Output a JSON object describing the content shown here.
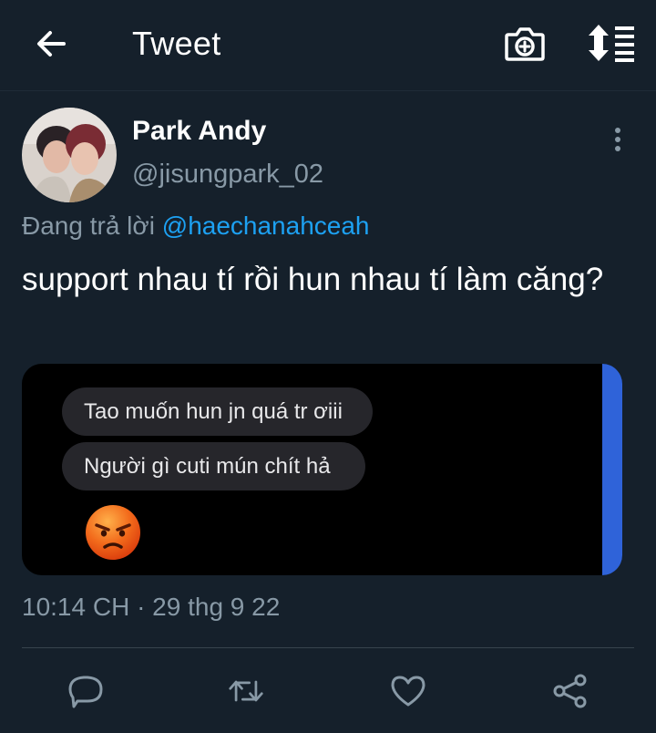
{
  "header": {
    "title": "Tweet",
    "icons": {
      "back": "arrow-left-icon",
      "camera": "camera-plus-icon",
      "sort": "sort-list-icon"
    }
  },
  "tweet": {
    "author": {
      "name": "Park Andy",
      "handle": "@jisungpark_02"
    },
    "reply": {
      "prefix": "Đang trả lời",
      "mention": "@haechanahceah"
    },
    "text": "support nhau tí rồi hun nhau tí làm căng?",
    "media": {
      "messages": [
        "Tao muốn hun jn quá tr ơiii",
        "Người gì cuti mún chít hả"
      ],
      "emoji": "angry-face-emoji",
      "accent_color": "#2f63d9"
    },
    "timestamp": "10:14 CH · 29 thg 9 22"
  },
  "actions": {
    "icons": [
      "reply-icon",
      "retweet-icon",
      "like-icon",
      "share-icon"
    ]
  },
  "colors": {
    "background": "#15202b",
    "secondary_text": "#8899a6",
    "link": "#1da1f2",
    "divider": "#38444d"
  }
}
